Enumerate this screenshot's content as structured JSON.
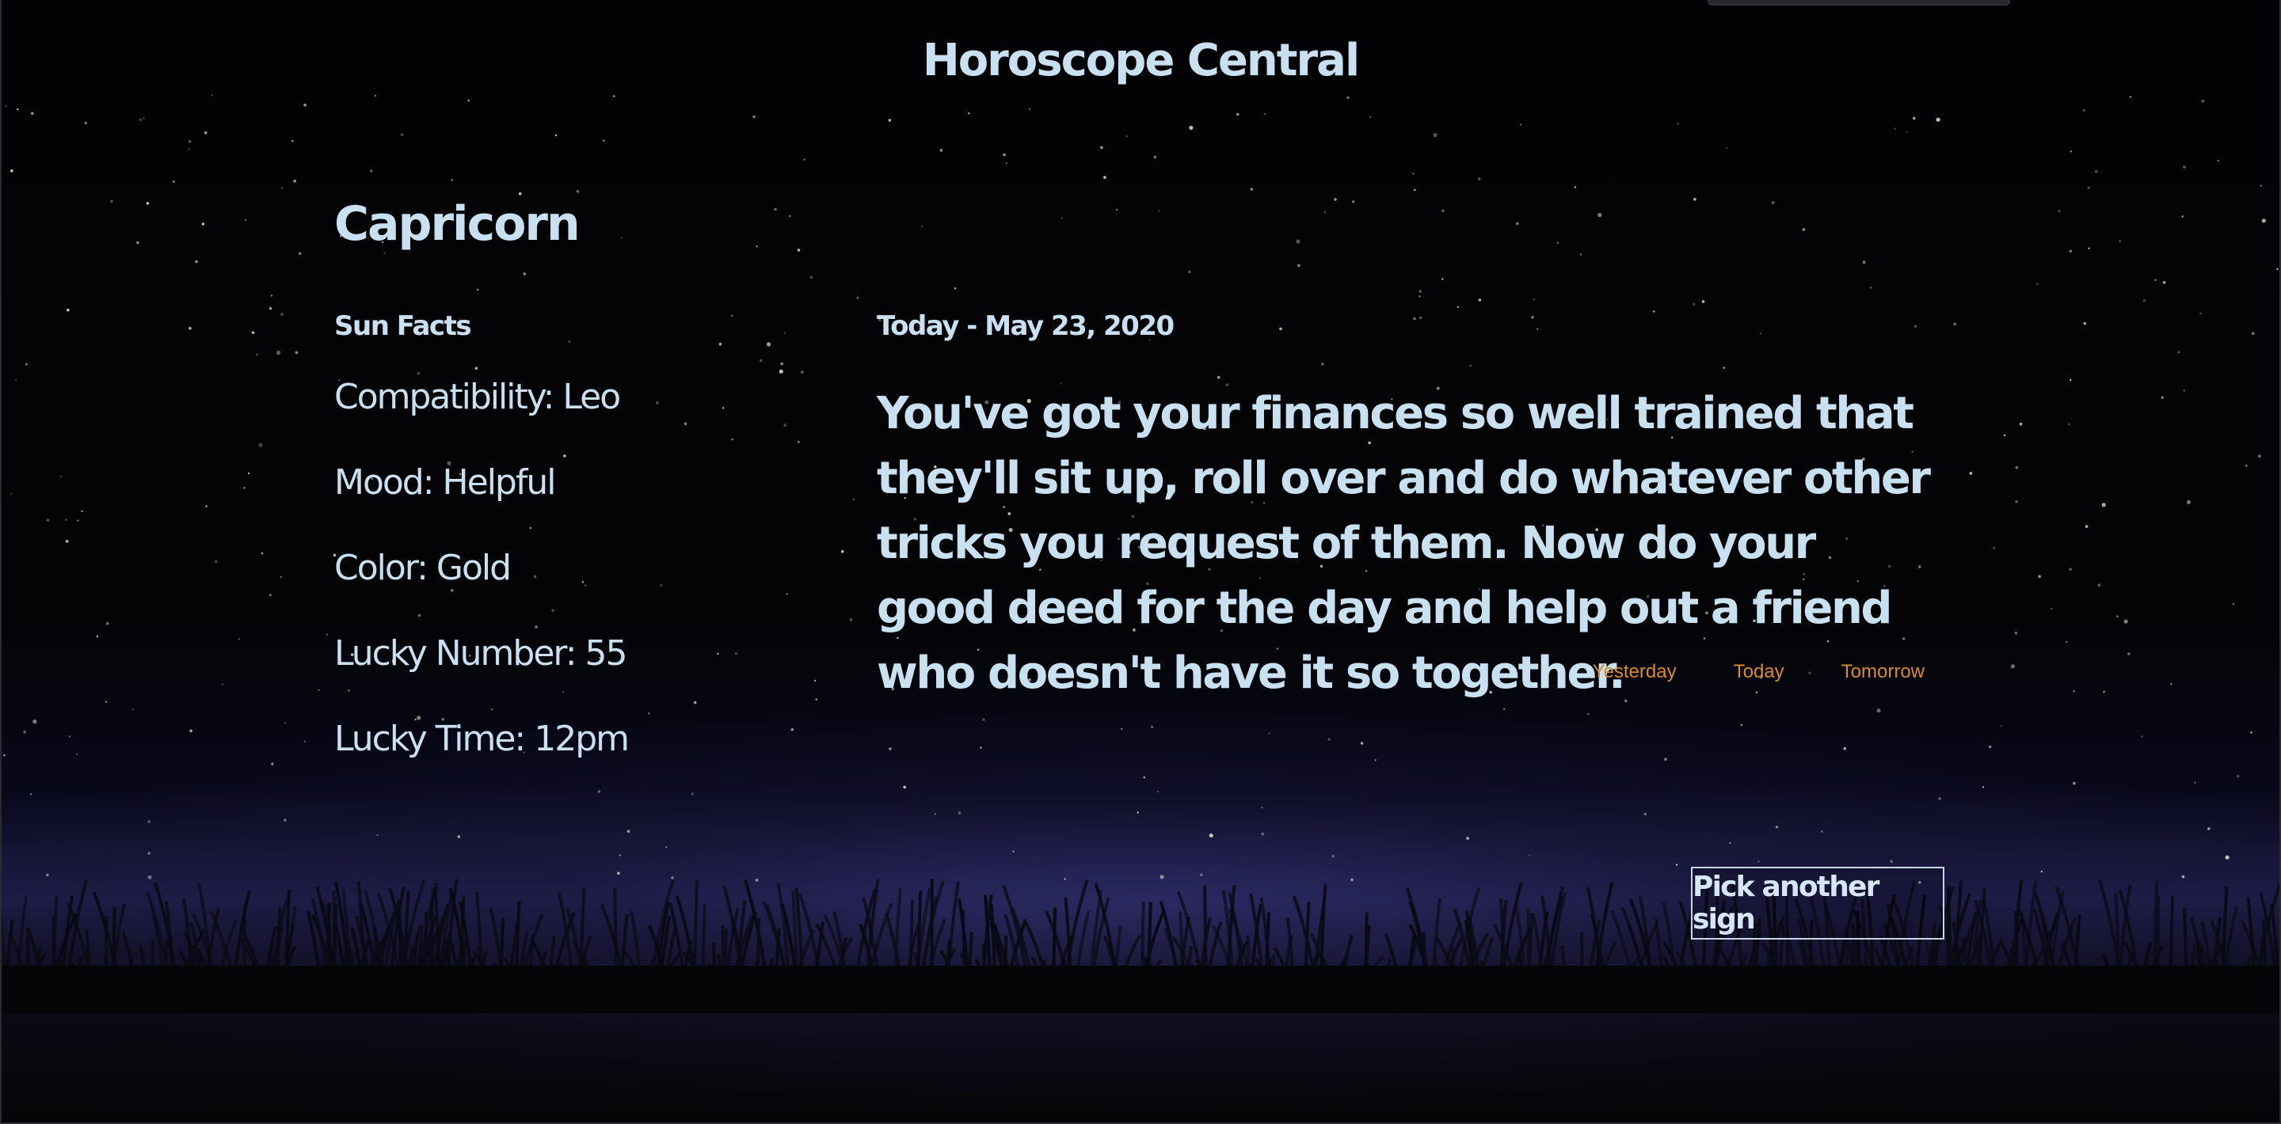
{
  "site": {
    "title": "Horoscope Central"
  },
  "sign": {
    "name": "Capricorn"
  },
  "facts": {
    "heading": "Sun Facts",
    "items": [
      "Compatibility: Leo",
      "Mood: Helpful",
      "Color: Gold",
      "Lucky Number: 55",
      "Lucky Time: 12pm"
    ]
  },
  "reading": {
    "date_label": "Today - May 23, 2020",
    "text": "You've got your finances so well trained that they'll sit up, roll over and do whatever other tricks you request of them. Now do your good deed for the day and help out a friend who doesn't have it so together."
  },
  "day_nav": {
    "yesterday": "Yesterday",
    "today": "Today",
    "tomorrow": "Tomorrow"
  },
  "actions": {
    "pick_another": "Pick another sign"
  },
  "colors": {
    "text": "#c9e0f1",
    "link": "#d98a2b",
    "background": "#050507"
  }
}
